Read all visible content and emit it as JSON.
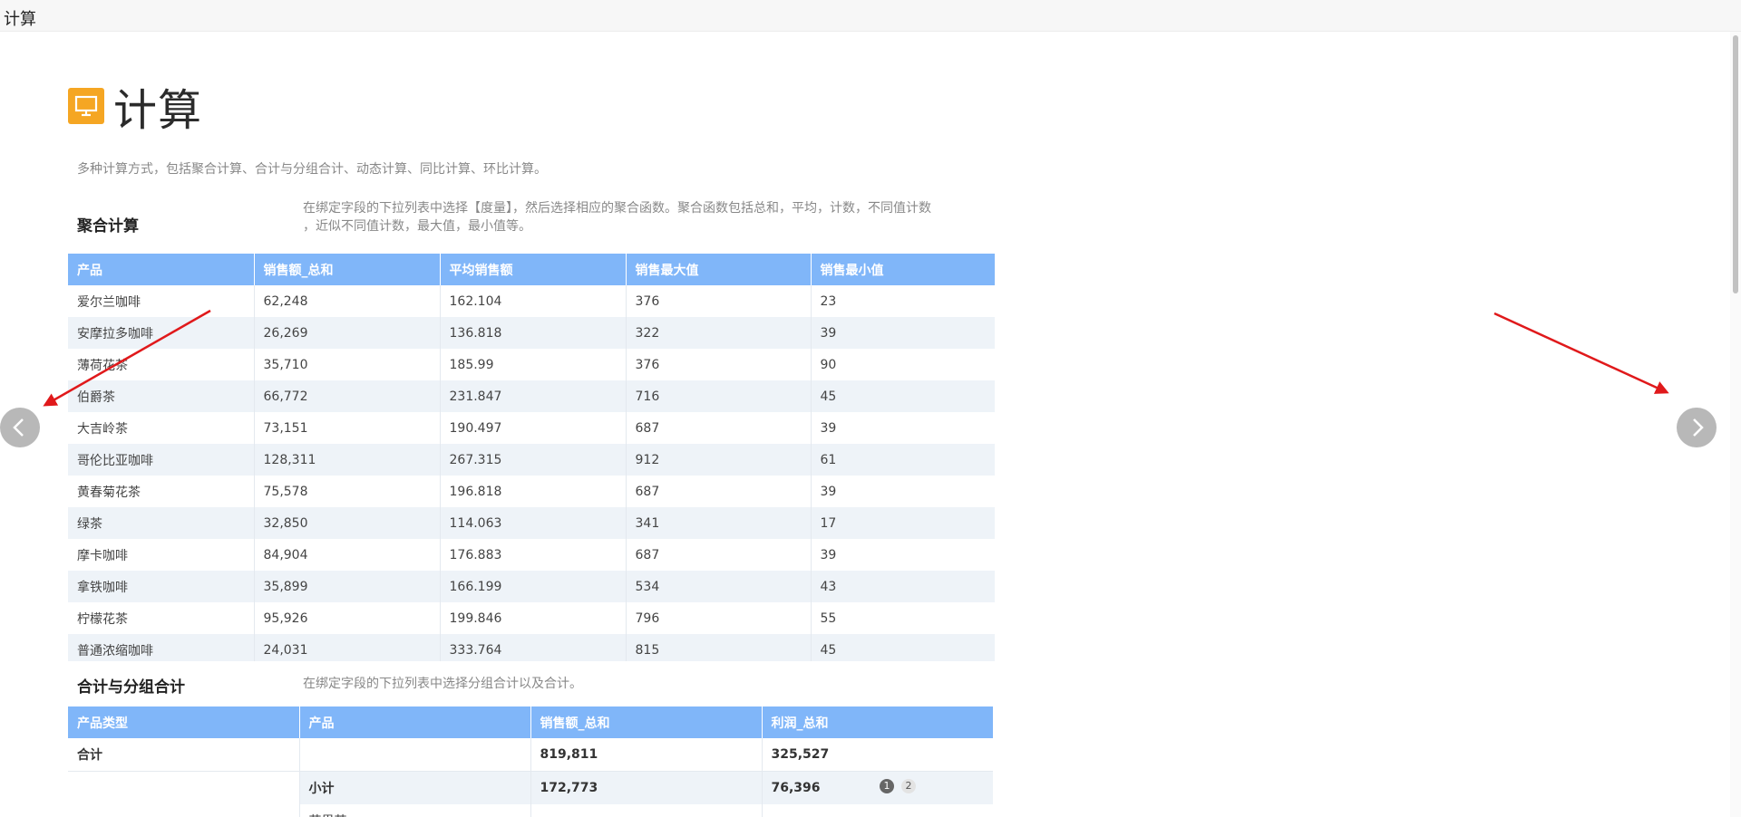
{
  "window": {
    "title": "计算"
  },
  "page": {
    "title": "计算",
    "description": "多种计算方式，包括聚合计算、合计与分组合计、动态计算、同比计算、环比计算。"
  },
  "section1": {
    "title": "聚合计算",
    "description_line1": "在绑定字段的下拉列表中选择【度量】，然后选择相应的聚合函数。聚合函数包括总和，平均，计数，不同值计数",
    "description_line2": "，近似不同值计数，最大值，最小值等。",
    "columns": [
      "产品",
      "销售额_总和",
      "平均销售额",
      "销售最大值",
      "销售最小值"
    ],
    "rows": [
      [
        "爱尔兰咖啡",
        "62,248",
        "162.104",
        "376",
        "23"
      ],
      [
        "安摩拉多咖啡",
        "26,269",
        "136.818",
        "322",
        "39"
      ],
      [
        "薄荷花茶",
        "35,710",
        "185.99",
        "376",
        "90"
      ],
      [
        "伯爵茶",
        "66,772",
        "231.847",
        "716",
        "45"
      ],
      [
        "大吉岭茶",
        "73,151",
        "190.497",
        "687",
        "39"
      ],
      [
        "哥伦比亚咖啡",
        "128,311",
        "267.315",
        "912",
        "61"
      ],
      [
        "黄春菊花茶",
        "75,578",
        "196.818",
        "687",
        "39"
      ],
      [
        "绿茶",
        "32,850",
        "114.063",
        "341",
        "17"
      ],
      [
        "摩卡咖啡",
        "84,904",
        "176.883",
        "687",
        "39"
      ],
      [
        "拿铁咖啡",
        "35,899",
        "166.199",
        "534",
        "43"
      ],
      [
        "柠檬花茶",
        "95,926",
        "199.846",
        "796",
        "55"
      ],
      [
        "普通浓缩咖啡",
        "24,031",
        "333.764",
        "815",
        "45"
      ]
    ]
  },
  "section2": {
    "title": "合计与分组合计",
    "description": "在绑定字段的下拉列表中选择分组合计以及合计。",
    "columns": [
      "产品类型",
      "产品",
      "销售额_总和",
      "利润_总和"
    ],
    "total_row": [
      "合计",
      "",
      "819,811",
      "325,527"
    ],
    "subtotal_row": [
      "",
      "小计",
      "172,773",
      "76,396"
    ],
    "partial_row": [
      "",
      "花果茶",
      "",
      ""
    ]
  },
  "pager": {
    "page1": "1",
    "page2": "2"
  },
  "icons": {
    "prev": "chevron-left-icon",
    "next": "chevron-right-icon",
    "page": "monitor-icon"
  },
  "colors": {
    "header_bg": "#80b6f9",
    "icon_bg": "#f5a623",
    "arrow": "#e0191b"
  }
}
